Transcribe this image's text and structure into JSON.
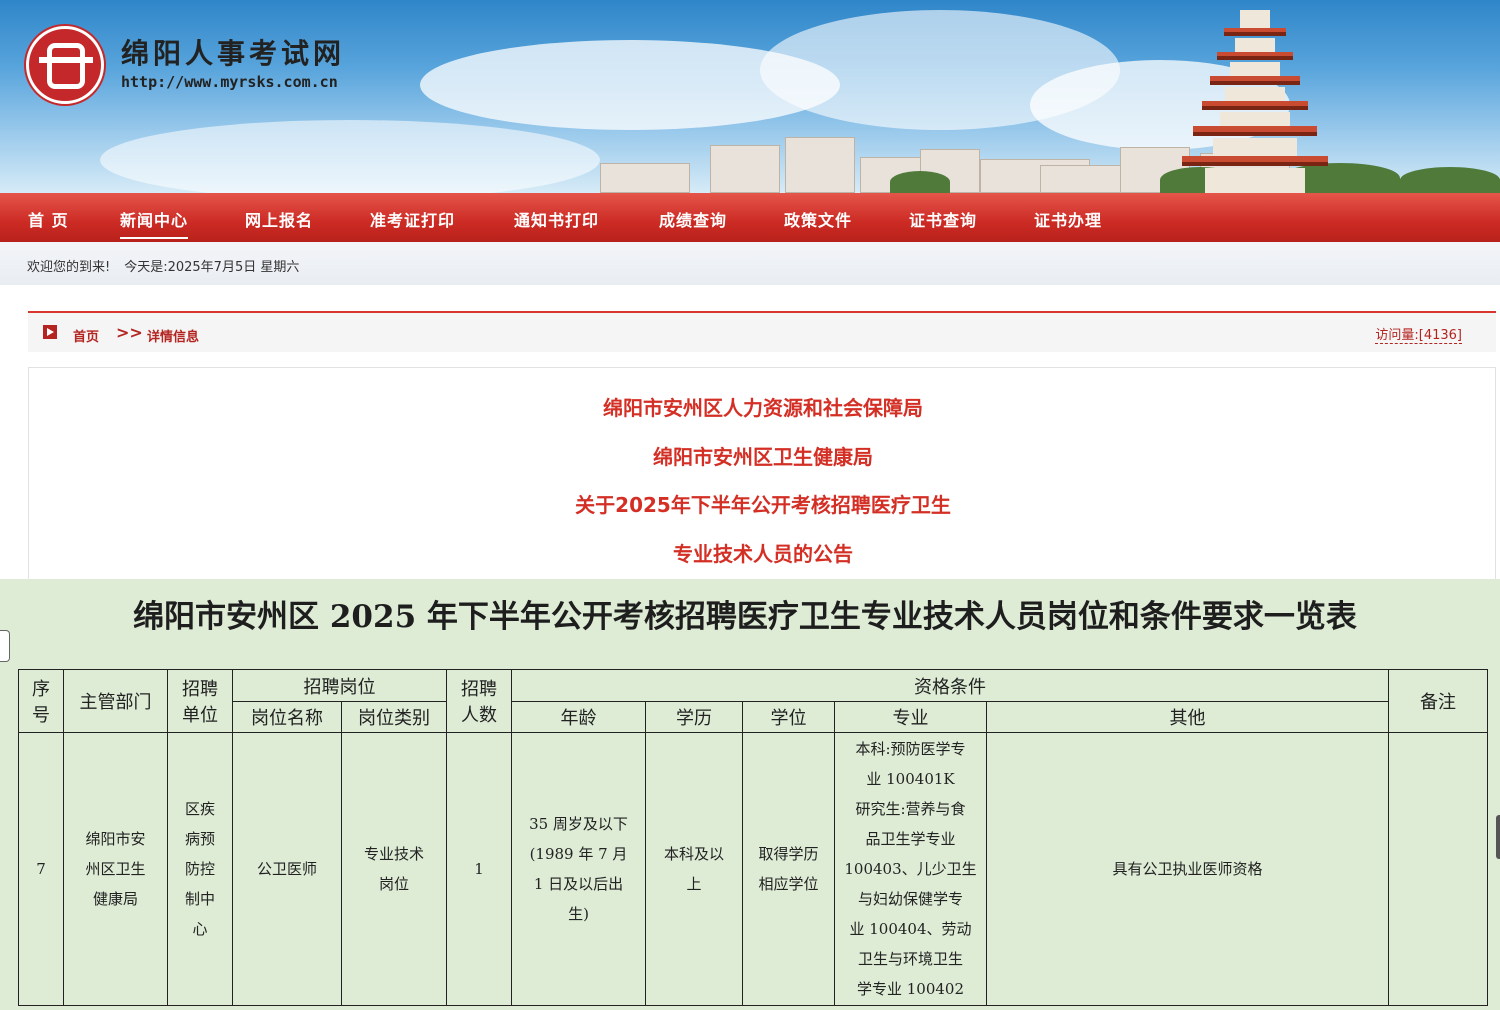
{
  "header": {
    "site_name": "绵阳人事考试网",
    "site_url": "http://www.myrsks.com.cn"
  },
  "nav": {
    "items": [
      {
        "label": "首 页"
      },
      {
        "label": "新闻中心"
      },
      {
        "label": "网上报名"
      },
      {
        "label": "准考证打印"
      },
      {
        "label": "通知书打印"
      },
      {
        "label": "成绩查询"
      },
      {
        "label": "政策文件"
      },
      {
        "label": "证书查询"
      },
      {
        "label": "证书办理"
      }
    ],
    "active_index": 1
  },
  "welcome": {
    "greeting": "欢迎您的到来!",
    "date": "今天是:2025年7月5日 星期六"
  },
  "breadcrumb": {
    "home": "首页",
    "separator": ">>",
    "current": "详情信息",
    "visits": "访问量:[4136]"
  },
  "article": {
    "lines": [
      "绵阳市安州区人力资源和社会保障局",
      "绵阳市安州区卫生健康局",
      "关于2025年下半年公开考核招聘医疗卫生",
      "专业技术人员的公告"
    ]
  },
  "table": {
    "title": "绵阳市安州区 2025 年下半年公开考核招聘医疗卫生专业技术人员岗位和条件要求一览表",
    "headers": {
      "seq": [
        "序",
        "号"
      ],
      "dept": "主管部门",
      "unit": [
        "招聘",
        "单位"
      ],
      "post_group": "招聘岗位",
      "post_name": "岗位名称",
      "post_type": "岗位类别",
      "count": [
        "招聘",
        "人数"
      ],
      "qual_group": "资格条件",
      "age": "年龄",
      "education": "学历",
      "degree": "学位",
      "major": "专业",
      "other": "其他",
      "remark": "备注"
    },
    "row": {
      "seq": "7",
      "dept": [
        "绵阳市安",
        "州区卫生",
        "健康局"
      ],
      "unit": [
        "区疾",
        "病预",
        "防控",
        "制中",
        "心"
      ],
      "post_name": "公卫医师",
      "post_type": [
        "专业技术",
        "岗位"
      ],
      "count": "1",
      "age": [
        "35 周岁及以下",
        "(1989 年 7 月",
        "1 日及以后出",
        "生)"
      ],
      "education": [
        "本科及以",
        "上"
      ],
      "degree": [
        "取得学历",
        "相应学位"
      ],
      "major": [
        "本科:预防医学专",
        "业 100401K",
        "研究生:营养与食",
        "品卫生学专业",
        "100403、儿少卫生",
        "与妇幼保健学专",
        "业 100404、劳动",
        "卫生与环境卫生",
        "学专业 100402"
      ],
      "other": "具有公卫执业医师资格",
      "remark": ""
    }
  }
}
